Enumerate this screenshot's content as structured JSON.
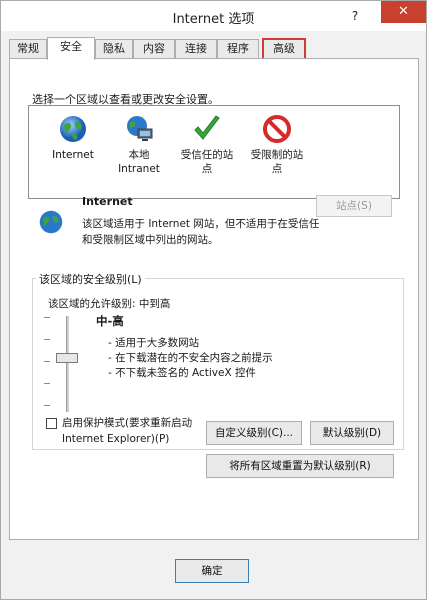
{
  "window": {
    "title": "Internet 选项",
    "help": "?",
    "close": "✕"
  },
  "tabs": [
    {
      "label": "常规"
    },
    {
      "label": "安全"
    },
    {
      "label": "隐私"
    },
    {
      "label": "内容"
    },
    {
      "label": "连接"
    },
    {
      "label": "程序"
    },
    {
      "label": "高级"
    }
  ],
  "security": {
    "intro": "选择一个区域以查看或更改安全设置。",
    "zones": [
      {
        "label": "Internet",
        "icon": "globe-icon"
      },
      {
        "label": "本地\nIntranet",
        "icon": "intranet-icon"
      },
      {
        "label": "受信任的站\n点",
        "icon": "checkmark-icon"
      },
      {
        "label": "受限制的站\n点",
        "icon": "restricted-icon"
      }
    ],
    "selected_zone_name": "Internet",
    "selected_zone_desc": "该区域适用于 Internet 网站，但不适用于在受信任和受限制区域中列出的网站。",
    "sites_button": "站点(S)",
    "level_group_title": "该区域的安全级别(L)",
    "allowed_levels": "该区域的允许级别: 中到高",
    "level_name": "中-高",
    "level_bullets": [
      "- 适用于大多数网站",
      "- 在下载潜在的不安全内容之前提示",
      "- 不下载未签名的 ActiveX 控件"
    ],
    "protected_mode_label": "启用保护模式(要求重新启动\nInternet Explorer)(P)",
    "protected_mode_checked": false,
    "custom_level_button": "自定义级别(C)...",
    "default_level_button": "默认级别(D)",
    "reset_all_button": "将所有区域重置为默认级别(R)"
  },
  "footer": {
    "ok_button": "确定"
  },
  "colors": {
    "highlight": "#d33b3b",
    "close": "#c8402e",
    "check": "#3aa63a",
    "restricted": "#d42a2a"
  }
}
